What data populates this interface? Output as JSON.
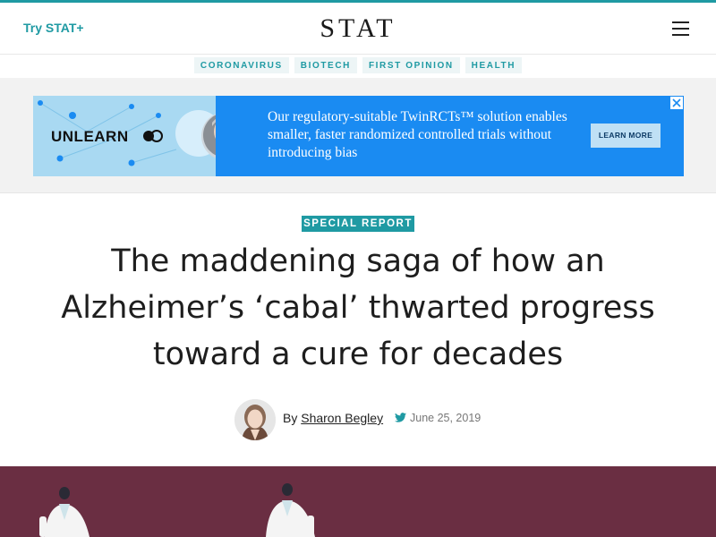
{
  "header": {
    "try_label": "Try STAT+",
    "logo": "STAT",
    "menu_icon": "hamburger-menu-icon"
  },
  "nav": {
    "items": [
      {
        "label": "CORONAVIRUS"
      },
      {
        "label": "BIOTECH"
      },
      {
        "label": "FIRST OPINION"
      },
      {
        "label": "HEALTH"
      }
    ]
  },
  "ad": {
    "brand": "UNLEARN",
    "text": "Our regulatory-suitable TwinRCTs™ solution enables smaller, faster randomized controlled trials without introducing bias",
    "button": "LEARN MORE",
    "close_icon": "ad-choices-close-icon"
  },
  "article": {
    "kicker": "SPECIAL REPORT",
    "headline": "The maddening saga of how an Alzheimer’s ‘cabal’ thwarted progress toward a cure for decades",
    "byline": {
      "prefix": "By ",
      "author": "Sharon Begley",
      "date": "June 25, 2019",
      "social_icon": "twitter-icon"
    }
  },
  "colors": {
    "accent": "#1f9aa3",
    "ad_blue": "#1a8bf2",
    "hero_bg": "#6a2e42"
  }
}
